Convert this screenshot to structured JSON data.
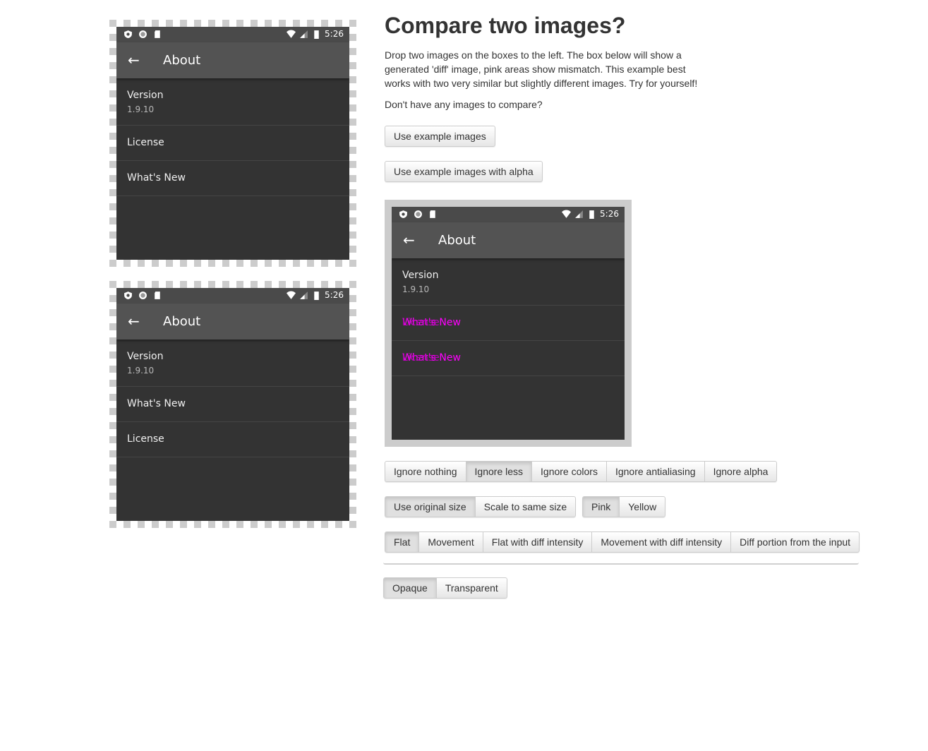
{
  "heading": "Compare two images?",
  "description": "Drop two images on the boxes to the left. The box below will show a generated 'diff' image, pink areas show mismatch. This example best works with two very similar but slightly different images. Try for yourself!",
  "no_images_prompt": "Don't have any images to compare?",
  "buttons": {
    "use_example": "Use example images",
    "use_example_alpha": "Use example images with alpha"
  },
  "colors": {
    "diff_highlight": "#ff00ff",
    "app_background": "#333333",
    "toolbar": "#535353"
  },
  "status_bar": {
    "time": "5:26"
  },
  "image1": {
    "toolbar_title": "About",
    "rows": [
      {
        "title": "Version",
        "subtitle": "1.9.10"
      },
      {
        "title": "License"
      },
      {
        "title": "What's New"
      }
    ]
  },
  "image2": {
    "toolbar_title": "About",
    "rows": [
      {
        "title": "Version",
        "subtitle": "1.9.10"
      },
      {
        "title": "What's New"
      },
      {
        "title": "License"
      }
    ]
  },
  "diff": {
    "toolbar_title": "About",
    "rows": [
      {
        "title": "Version",
        "subtitle": "1.9.10"
      },
      {
        "title": "What's New"
      },
      {
        "title": "What's New"
      }
    ],
    "overlay_rows": [
      "License",
      "License"
    ]
  },
  "ignore_options": {
    "items": [
      "Ignore nothing",
      "Ignore less",
      "Ignore colors",
      "Ignore antialiasing",
      "Ignore alpha"
    ],
    "selected": "Ignore less"
  },
  "size_options": {
    "items": [
      "Use original size",
      "Scale to same size"
    ],
    "selected": "Use original size"
  },
  "color_options": {
    "items": [
      "Pink",
      "Yellow"
    ],
    "selected": "Pink"
  },
  "mode_options": {
    "items": [
      "Flat",
      "Movement",
      "Flat with diff intensity",
      "Movement with diff intensity",
      "Diff portion from the input"
    ],
    "selected": "Flat"
  },
  "opacity_options": {
    "items": [
      "Opaque",
      "Transparent"
    ],
    "selected": "Opaque"
  }
}
